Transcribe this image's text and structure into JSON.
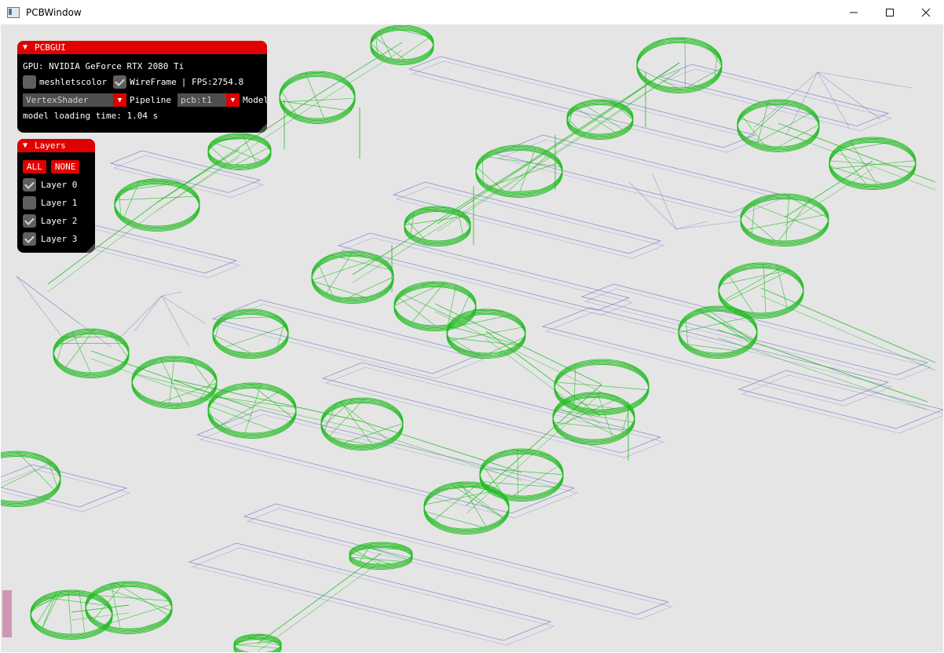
{
  "window": {
    "title": "PCBWindow",
    "minimize_icon": "minimize-icon",
    "maximize_icon": "maximize-icon",
    "close_icon": "close-icon"
  },
  "pcbgui": {
    "title": "PCBGUI",
    "gpu_text": "GPU: NVIDIA GeForce RTX 2080 Ti",
    "meshletscolor_label": "meshletscolor",
    "meshletscolor_checked": false,
    "wireframe_label": "WireFrame",
    "wireframe_checked": true,
    "fps_text": "| FPS:2754.8",
    "shader_value": "VertexShader",
    "pipeline_label": "Pipeline",
    "model_value": "pcb:t1",
    "model_label": "Model",
    "loading_text": "model loading time: 1.04 s"
  },
  "layers": {
    "title": "Layers",
    "all_label": "ALL",
    "none_label": "NONE",
    "items": [
      {
        "label": "Layer 0",
        "checked": true
      },
      {
        "label": "Layer 1",
        "checked": false
      },
      {
        "label": "Layer 2",
        "checked": true
      },
      {
        "label": "Layer 3",
        "checked": true
      }
    ]
  },
  "colors": {
    "viewport_bg": "#e5e5e5",
    "wire_green": "#22bb22",
    "wire_blue": "#7777cc",
    "accent_red": "#e00000"
  }
}
